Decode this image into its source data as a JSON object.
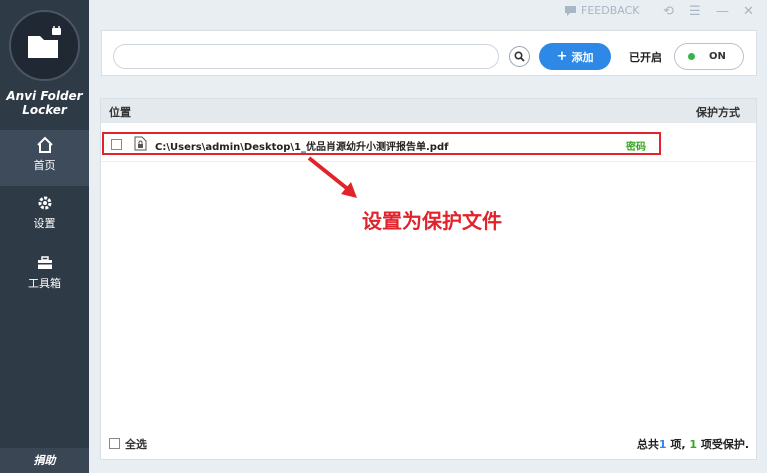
{
  "app": {
    "name": "Anvi Folder Locker"
  },
  "titlebar": {
    "feedback": "FEEDBACK"
  },
  "sidebar": {
    "items": [
      {
        "label": "首页",
        "icon": "home-icon"
      },
      {
        "label": "设置",
        "icon": "gear-icon"
      },
      {
        "label": "工具箱",
        "icon": "toolbox-icon"
      }
    ],
    "donate": "捐助"
  },
  "toolbar": {
    "search_value": "",
    "add_label": "添加",
    "status_label": "已开启",
    "toggle_label": "ON"
  },
  "list": {
    "columns": [
      "位置",
      "保护方式"
    ],
    "rows": [
      {
        "path": "C:\\Users\\admin\\Desktop\\1_优品肖源幼升小测评报告单.pdf",
        "mode": "密码"
      }
    ]
  },
  "footer": {
    "select_all": "全选",
    "summary_prefix": "总共",
    "total": "1",
    "summary_mid": " 项, ",
    "protected": "1",
    "summary_suffix": " 项受保护."
  },
  "annotation": {
    "text": "设置为保护文件"
  },
  "colors": {
    "sidebar": "#2f3a47",
    "accent": "#2d89e5",
    "highlight": "#e1232b",
    "mode": "#3aa620"
  }
}
